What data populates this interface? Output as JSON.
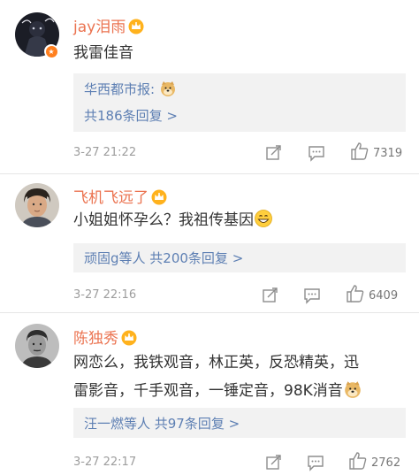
{
  "comments": [
    {
      "username": "jay泪雨",
      "text": "我雷佳音",
      "reply_author": "华西都市报",
      "reply_colon": ":",
      "reply_more": "共186条回复 >",
      "timestamp": "3-27 21:22",
      "likes": "7319"
    },
    {
      "username": "飞机飞远了",
      "text": "小姐姐怀孕么？我祖传基因",
      "reply_more": "顽固g等人 共200条回复 >",
      "timestamp": "3-27 22:16",
      "likes": "6409"
    },
    {
      "username": "陈独秀",
      "text_line1": "网恋么，我铁观音，林正英，反恐精英，迅",
      "text_line2": "雷影音，千手观音，一锤定音，98K消音",
      "reply_more": "汪一燃等人 共97条回复 >",
      "timestamp": "3-27 22:17",
      "likes": "2762"
    }
  ],
  "colors": {
    "username": "#eb7350",
    "reply_link": "#5d7fb3",
    "reply_bg": "#f2f2f2",
    "meta": "#9d9d9d"
  },
  "icons": [
    "crown-badge-icon",
    "vip-badge-icon",
    "share-icon",
    "comment-icon",
    "thumbs-up-icon",
    "doge-emoji-icon",
    "grin-emoji-icon"
  ]
}
